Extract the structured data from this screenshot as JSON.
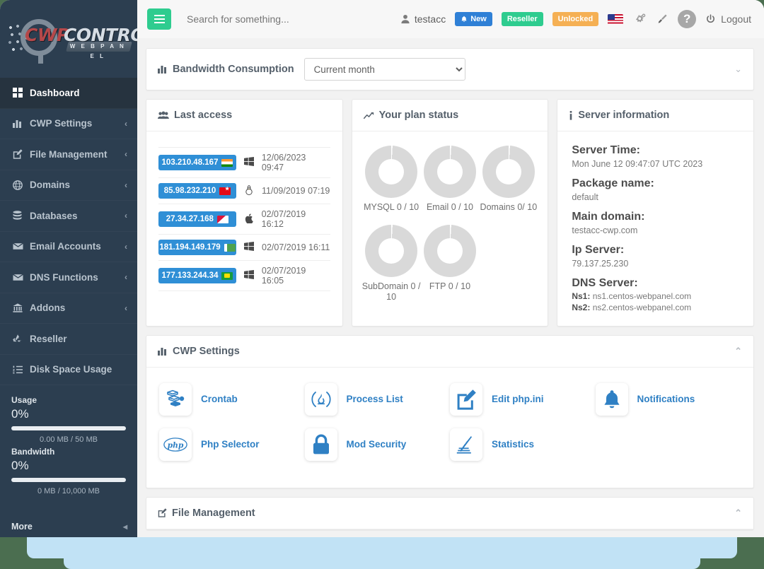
{
  "brand": {
    "logo_primary": "CWP",
    "logo_secondary": "CONTROL",
    "logo_tagline": "W E B   P A N E L"
  },
  "sidebar": {
    "items": [
      {
        "label": "Dashboard",
        "icon": "grid-icon",
        "active": true,
        "caret": ""
      },
      {
        "label": "CWP Settings",
        "icon": "chart-bar-icon",
        "active": false,
        "caret": "‹"
      },
      {
        "label": "File Management",
        "icon": "edit-square-icon",
        "active": false,
        "caret": "‹"
      },
      {
        "label": "Domains",
        "icon": "globe-icon",
        "active": false,
        "caret": "‹"
      },
      {
        "label": "Databases",
        "icon": "database-icon",
        "active": false,
        "caret": "‹"
      },
      {
        "label": "Email Accounts",
        "icon": "envelope-icon",
        "active": false,
        "caret": "‹"
      },
      {
        "label": "DNS Functions",
        "icon": "envelope-icon",
        "active": false,
        "caret": "‹"
      },
      {
        "label": "Addons",
        "icon": "bank-icon",
        "active": false,
        "caret": "‹"
      },
      {
        "label": "Reseller",
        "icon": "recycle-icon",
        "active": false,
        "caret": ""
      },
      {
        "label": "Disk Space Usage",
        "icon": "list-ol-icon",
        "active": false,
        "caret": ""
      }
    ],
    "usage": {
      "title": "Usage",
      "percent_label": "0%",
      "percent_value": 0,
      "detail": "0.00 MB / 50 MB"
    },
    "bandwidth": {
      "title": "Bandwidth",
      "percent_label": "0%",
      "percent_value": 0,
      "detail": "0 MB / 10,000 MB"
    },
    "more_label": "More",
    "more_caret": "◂"
  },
  "topbar": {
    "search_placeholder": "Search for something...",
    "username": "testacc",
    "new_badge": "New",
    "reseller_badge": "Reseller",
    "unlocked_badge": "Unlocked",
    "flag": "us-flag-icon",
    "logout_label": "Logout",
    "help_glyph": "?"
  },
  "bandwidth_panel": {
    "title": "Bandwidth Consumption",
    "selected_option": "Current month",
    "options": [
      "Current month"
    ]
  },
  "last_access": {
    "title": "Last access",
    "rows": [
      {
        "ip": "103.210.48.167",
        "flag": "in",
        "os": "windows-icon",
        "date": "12/06/2023 09:47"
      },
      {
        "ip": "85.98.232.210",
        "flag": "tr",
        "os": "linux-icon",
        "date": "11/09/2019 07:19"
      },
      {
        "ip": "27.34.27.168",
        "flag": "np",
        "os": "apple-icon",
        "date": "02/07/2019 16:12"
      },
      {
        "ip": "181.194.149.179",
        "flag": "pk",
        "os": "windows-icon",
        "date": "02/07/2019 16:11"
      },
      {
        "ip": "177.133.244.34",
        "flag": "br",
        "os": "windows-icon",
        "date": "02/07/2019 16:05"
      }
    ]
  },
  "plan_status": {
    "title": "Your plan status",
    "items": [
      {
        "label": "MYSQL 0 / 10",
        "used": 0,
        "limit": 10
      },
      {
        "label": "Email 0 / 10",
        "used": 0,
        "limit": 10
      },
      {
        "label": "Domains 0/ 10",
        "used": 0,
        "limit": 10
      },
      {
        "label": "SubDomain 0 / 10",
        "used": 0,
        "limit": 10
      },
      {
        "label": "FTP 0 / 10",
        "used": 0,
        "limit": 10
      }
    ]
  },
  "server_info": {
    "title": "Server information",
    "server_time_label": "Server Time:",
    "server_time_value": "Mon June 12 09:47:07 UTC 2023",
    "package_label": "Package name:",
    "package_value": "default",
    "domain_label": "Main domain:",
    "domain_value": "testacc-cwp.com",
    "ip_label": "Ip Server:",
    "ip_value": "79.137.25.230",
    "dns_label": "DNS Server:",
    "ns1_key": "Ns1:",
    "ns1_value": "ns1.centos-webpanel.com",
    "ns2_key": "Ns2:",
    "ns2_value": "ns2.centos-webpanel.com"
  },
  "cwp_settings": {
    "title": "CWP Settings",
    "shortcuts": [
      {
        "label": "Crontab",
        "icon": "crontab-icon"
      },
      {
        "label": "Process List",
        "icon": "fire-icon"
      },
      {
        "label": "Edit php.ini",
        "icon": "edit-square-icon"
      },
      {
        "label": "Notifications",
        "icon": "bell-icon"
      },
      {
        "label": "Php Selector",
        "icon": "php-icon"
      },
      {
        "label": "Mod Security",
        "icon": "lock-icon"
      },
      {
        "label": "Statistics",
        "icon": "statistics-icon"
      }
    ]
  },
  "file_management": {
    "title": "File Management"
  },
  "colors": {
    "sidebar_bg": "#2c3e50",
    "accent_blue": "#2f80c4",
    "badge_blue": "#2f8fd6",
    "green": "#2ecc8f",
    "orange": "#f5b054",
    "page_bg": "#f2f2f2",
    "desktop_bg": "#4b6e50",
    "card_blue": "#c1e2f5"
  }
}
